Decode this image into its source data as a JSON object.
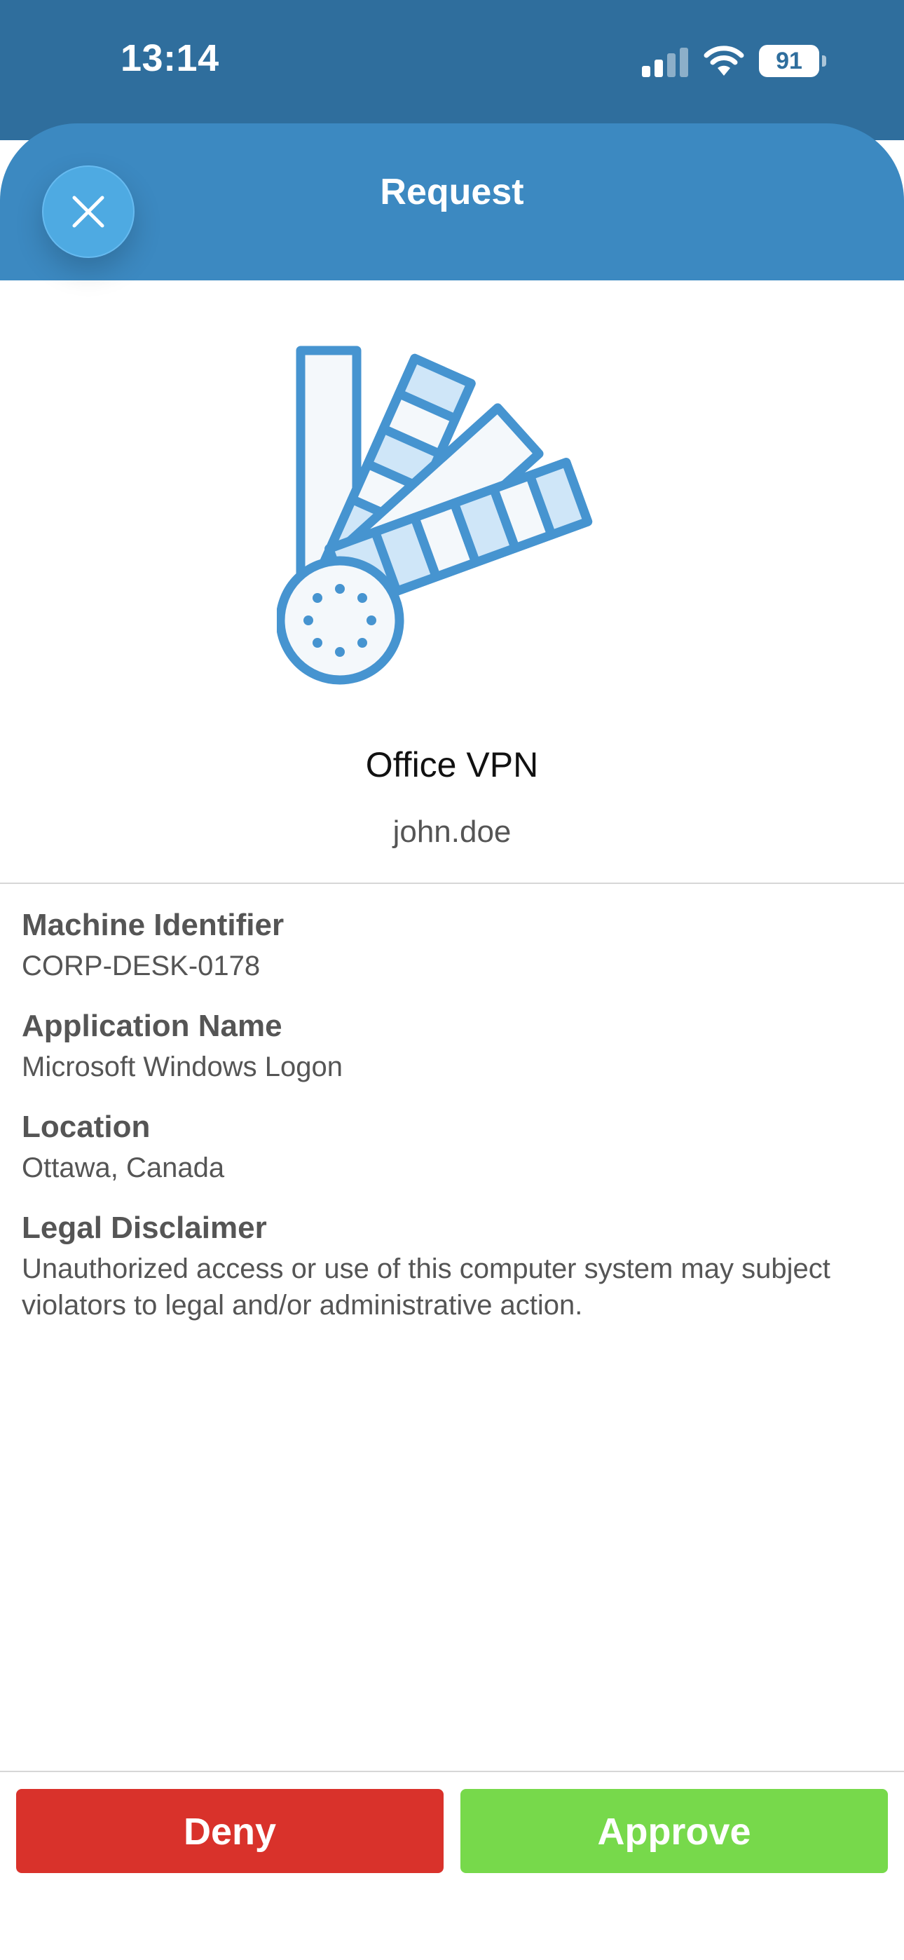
{
  "status_bar": {
    "time": "13:14",
    "battery_level": "91",
    "signal_bars_active": 2,
    "signal_bars_total": 4
  },
  "header": {
    "title": "Request"
  },
  "icons": {
    "close": "close-icon",
    "app": "color-swatch-icon",
    "signal": "cellular-signal-icon",
    "wifi": "wifi-icon",
    "battery": "battery-icon"
  },
  "request": {
    "app_name": "Office VPN",
    "username": "john.doe"
  },
  "details": [
    {
      "label": "Machine Identifier",
      "value": "CORP-DESK-0178"
    },
    {
      "label": "Application Name",
      "value": "Microsoft Windows Logon"
    },
    {
      "label": "Location",
      "value": "Ottawa, Canada"
    },
    {
      "label": "Legal Disclaimer",
      "value": "Unauthorized access or use of this computer system may subject violators to legal and/or administrative action."
    }
  ],
  "actions": {
    "deny_label": "Deny",
    "approve_label": "Approve"
  },
  "colors": {
    "status_bar": "#2f6e9d",
    "header": "#3c89c1",
    "close_button": "#4eaae2",
    "deny": "#d9322b",
    "approve": "#77d94b",
    "icon_stroke": "#4694d0",
    "icon_fill_light": "#cfe6f8"
  }
}
